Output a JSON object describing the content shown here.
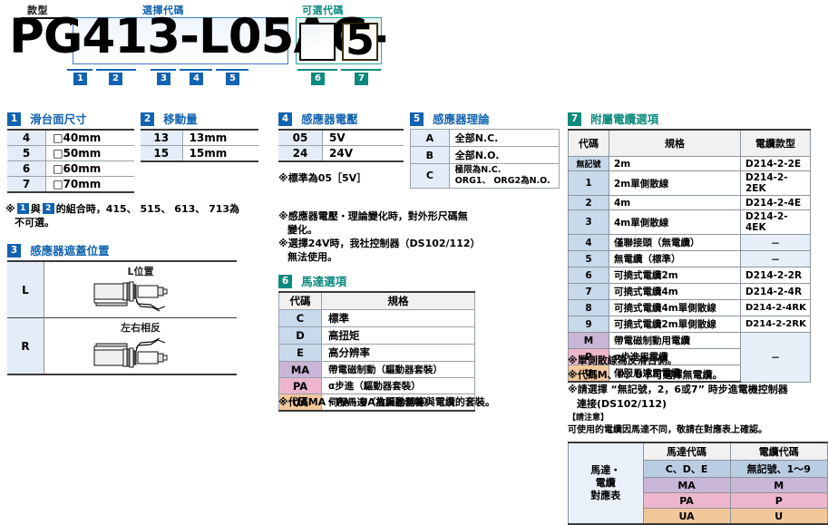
{
  "header": {
    "label_model": "款型",
    "label_select": "選擇代碼",
    "label_option": "可選代碼",
    "code_text": "PG413-L05AG-",
    "option_box_empty": "",
    "option_box_value": "5",
    "chips": [
      "1",
      "2",
      "3",
      "4",
      "5",
      "6",
      "7"
    ],
    "accent_blue": "#1263b0",
    "accent_teal": "#0c8a7d"
  },
  "sec1": {
    "num": "1",
    "title": "滑台面尺寸",
    "rows": [
      {
        "code": "4",
        "spec": "□40mm"
      },
      {
        "code": "5",
        "spec": "□50mm"
      },
      {
        "code": "6",
        "spec": "□60mm"
      },
      {
        "code": "7",
        "spec": "□70mm"
      }
    ],
    "note_a": "的組合時，415、 515、 613、 713為",
    "note_b": "不可選。",
    "note_mid": "與",
    "note_chip1": "1",
    "note_chip2": "2"
  },
  "sec2": {
    "num": "2",
    "title": "移動量",
    "rows": [
      {
        "code": "13",
        "spec": "13mm"
      },
      {
        "code": "15",
        "spec": "15mm"
      }
    ]
  },
  "sec3": {
    "num": "3",
    "title": "感應器遮蓋位置",
    "rows": [
      {
        "code": "L",
        "caption": "L位置"
      },
      {
        "code": "R",
        "caption": "左右相反"
      }
    ]
  },
  "sec4": {
    "num": "4",
    "title": "感應器電壓",
    "rows": [
      {
        "code": "05",
        "spec": "5V"
      },
      {
        "code": "24",
        "spec": "24V"
      }
    ],
    "note1": "※標準為05［5V］",
    "note2": "※感應器電壓・理論變化時，對外形尺碼無",
    "note2b": "變化。",
    "note3": "※選擇24V時，我社控制器（DS102/112）",
    "note3b": "無法使用。"
  },
  "sec5": {
    "num": "5",
    "title": "感應器理論",
    "rows": [
      {
        "code": "A",
        "spec": "全部N.C.",
        "spec2": ""
      },
      {
        "code": "B",
        "spec": "全部N.O.",
        "spec2": ""
      },
      {
        "code": "C",
        "spec": "極限為N.C.",
        "spec2": "ORG1、 ORG2為N.O."
      }
    ]
  },
  "sec6": {
    "num": "6",
    "title": "馬達選項",
    "headers": [
      "代碼",
      "規格"
    ],
    "rows": [
      {
        "code": "C",
        "spec": "標準",
        "color": "#c9d9ec"
      },
      {
        "code": "D",
        "spec": "高扭矩",
        "color": "#c9d9ec"
      },
      {
        "code": "E",
        "spec": "高分辨率",
        "color": "#c9d9ec"
      },
      {
        "code": "MA",
        "spec": "帶電磁制動（驅動器套裝）",
        "color": "#c9b6d6"
      },
      {
        "code": "PA",
        "spec": "α步進（驅動器套裝）",
        "color": "#edb6cc"
      },
      {
        "code": "UA",
        "spec": "伺服馬達（放大器套裝）",
        "color": "#f2c79a"
      }
    ],
    "note": "※代碼MA・PA・UA為驅動器等與電纜的套裝。"
  },
  "sec7": {
    "num": "7",
    "title": "附屬電纜選項",
    "headers": [
      "代碼",
      "規格",
      "電纜款型"
    ],
    "rows": [
      {
        "code": "無記號",
        "spec": "2m",
        "model": "D214-2-2E",
        "color": "#c9d9ec"
      },
      {
        "code": "1",
        "spec": "2m單側散線",
        "model": "D214-2-2EK",
        "color": "#c9d9ec"
      },
      {
        "code": "2",
        "spec": "4m",
        "model": "D214-2-4E",
        "color": "#c9d9ec"
      },
      {
        "code": "3",
        "spec": "4m單側散線",
        "model": "D214-2-4EK",
        "color": "#c9d9ec"
      },
      {
        "code": "4",
        "spec": "僅聯接頭（無電纜）",
        "model": "－",
        "color": "#c9d9ec"
      },
      {
        "code": "5",
        "spec": "無電纜（標準）",
        "model": "－",
        "color": "#c9d9ec"
      },
      {
        "code": "6",
        "spec": "可撓式電纜2m",
        "model": "D214-2-2R",
        "color": "#c9d9ec"
      },
      {
        "code": "7",
        "spec": "可撓式電纜4m",
        "model": "D214-2-4R",
        "color": "#c9d9ec"
      },
      {
        "code": "8",
        "spec": "可撓式電纜4m單側散線",
        "model": "D214-2-4RK",
        "color": "#c9d9ec"
      },
      {
        "code": "9",
        "spec": "可撓式電纜2m單側散線",
        "model": "D214-2-2RK",
        "color": "#c9d9ec"
      },
      {
        "code": "M",
        "spec": "帶電磁制動用電纜",
        "model": "",
        "color": "#c9b6d6"
      },
      {
        "code": "P",
        "spec": "α步進用電纜",
        "model": "－",
        "color": "#edb6cc"
      },
      {
        "code": "U",
        "spec": "伺服馬達用電纜",
        "model": "",
        "color": "#f2c79a"
      }
    ],
    "note1": "※單側散線為反滑台側。",
    "note2": "※代碼M、P、U不可選擇無電纜。",
    "note3": "※請選擇 “無記號，2，6或7” 時步進電機控制器",
    "note3b": "連接(DS102/112)",
    "caution_title": "【請注意】",
    "caution_body": "可使用的電纜因馬達不同，敬請在對應表上確認。"
  },
  "corr": {
    "side_label": "馬達・\n電纜\n對應表",
    "side_l1": "馬達・",
    "side_l2": "電纜",
    "side_l3": "對應表",
    "headers": [
      "馬達代碼",
      "電纜代碼"
    ],
    "rows": [
      {
        "motor": "C、D、E",
        "cable": "無記號、1～9",
        "color": "#b9cde3"
      },
      {
        "motor": "MA",
        "cable": "M",
        "color": "#c9b6d6"
      },
      {
        "motor": "PA",
        "cable": "P",
        "color": "#edb6cc"
      },
      {
        "motor": "UA",
        "cable": "U",
        "color": "#f2c79a"
      }
    ]
  }
}
